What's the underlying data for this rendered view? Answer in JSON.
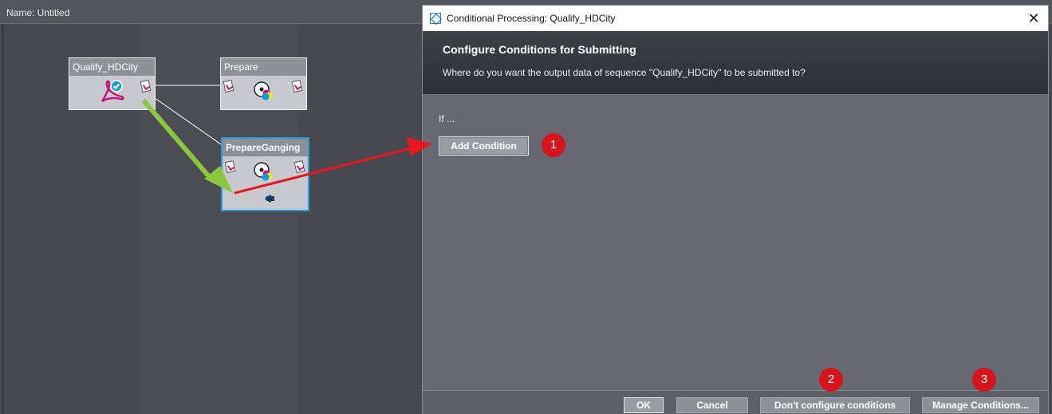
{
  "canvas": {
    "title": "Name: Untitled",
    "nodes": [
      {
        "label": "Qualify_HDCity"
      },
      {
        "label": "Prepare"
      },
      {
        "label": "PrepareGanging"
      }
    ]
  },
  "dialog": {
    "title": "Conditional Processing: Qualify_HDCity",
    "close_symbol": "✕",
    "heading": "Configure Conditions for Submitting",
    "subtitle": "Where do you want the output data of sequence \"Qualify_HDCity\" to be submitted to?",
    "if_label": "If ...",
    "add_condition_label": "Add Condition",
    "footer": {
      "ok_label": "OK",
      "cancel_label": "Cancel",
      "dont_configure_label": "Don't configure conditions",
      "manage_label": "Manage Conditions..."
    }
  },
  "annotations": {
    "badge_1": "1",
    "badge_2": "2",
    "badge_3": "3",
    "arrow_red_color": "#e8161d",
    "arrow_green_color": "#8dc63f"
  },
  "colors": {
    "selection_border": "#2a9bd6",
    "badge": "#d5141b"
  }
}
